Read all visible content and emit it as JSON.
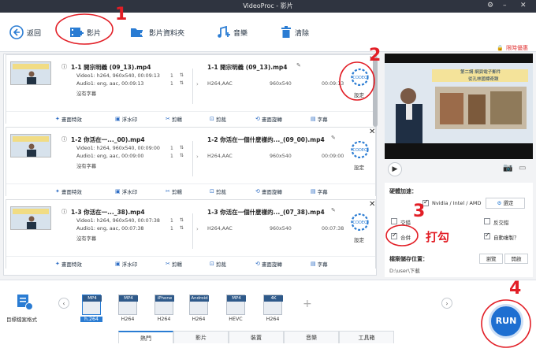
{
  "titlebar": {
    "title": "VideoProc - 影片"
  },
  "toolbar": {
    "back": "返回",
    "video": "影片",
    "video_folder": "影片資料夾",
    "music": "音樂",
    "clear": "清除",
    "promo": "限時優惠"
  },
  "files": [
    {
      "title": "1-1 開宗明義 (09_13).mp4",
      "video": "Video1: h264, 960x540, 00:09:13",
      "audio": "Audio1: eng, aac, 00:09:13",
      "subs": "沒有字幕",
      "vcount": "1",
      "acount": "1",
      "out_title": "1-1 開宗明義 (09_13).mp4",
      "out_codec": "H264,AAC",
      "out_res": "960x540",
      "out_dur": "00:09:13"
    },
    {
      "title": "1-2 你活在一..._00).mp4",
      "video": "Video1: h264, 960x540, 00:09:00",
      "audio": "Audio1: eng, aac, 00:09:00",
      "subs": "沒有字幕",
      "vcount": "1",
      "acount": "1",
      "out_title": "1-2 你活在一個什麼樣的..._(09_00).mp4",
      "out_codec": "H264,AAC",
      "out_res": "960x540",
      "out_dur": "00:09:00"
    },
    {
      "title": "1-3 你活在一..._38).mp4",
      "video": "Video1: h264, 960x540, 00:07:38",
      "audio": "Audio1: eng, aac, 00:07:38",
      "subs": "沒有字幕",
      "vcount": "1",
      "acount": "1",
      "out_title": "1-3 你活在一個什麼樣的..._(07_38).mp4",
      "out_codec": "H264,AAC",
      "out_res": "960x540",
      "out_dur": "00:07:38"
    }
  ],
  "card_ui": {
    "codec_label": "設定",
    "codec_icon": "CODEC"
  },
  "actions": [
    "畫面特效",
    "浮水印",
    "剪輯",
    "剪裁",
    "畫面旋轉",
    "字幕"
  ],
  "settings": {
    "hw_label": "硬體加速：",
    "hw_option": "Nvidia / Intel / AMD",
    "hw_btn": "選定",
    "deint": "交錯",
    "reverse": "反交錯",
    "merge": "合併",
    "auto_copy": "自動複製？",
    "output_label": "檔案儲存位置：",
    "browse": "瀏覽",
    "open": "開啟",
    "path": "D:\\user\\下載"
  },
  "annotations": {
    "n1": "1",
    "n2": "2",
    "n3": "3",
    "n4": "4",
    "check_note": "打勾"
  },
  "formats": {
    "target": "目標檔案格式",
    "items": [
      {
        "tag": "MP4",
        "cap": "h.264"
      },
      {
        "tag": "MP4",
        "cap": "H264"
      },
      {
        "tag": "iPhone",
        "cap": "H264"
      },
      {
        "tag": "Android",
        "cap": "H264"
      },
      {
        "tag": "MP4",
        "cap": "HEVC"
      },
      {
        "tag": "4K",
        "cap": "H264"
      }
    ],
    "add": "+",
    "tabs": [
      "熱門",
      "影片",
      "裝置",
      "音樂",
      "工具箱"
    ]
  },
  "run": "RUN",
  "slide": {
    "line1": "第二講 網頁電子郵件",
    "line2": "從孔林國標奇蹟"
  },
  "colors": {
    "accent": "#2a7cd3",
    "annotation": "#e21e26",
    "titlebar": "#2f3440"
  }
}
